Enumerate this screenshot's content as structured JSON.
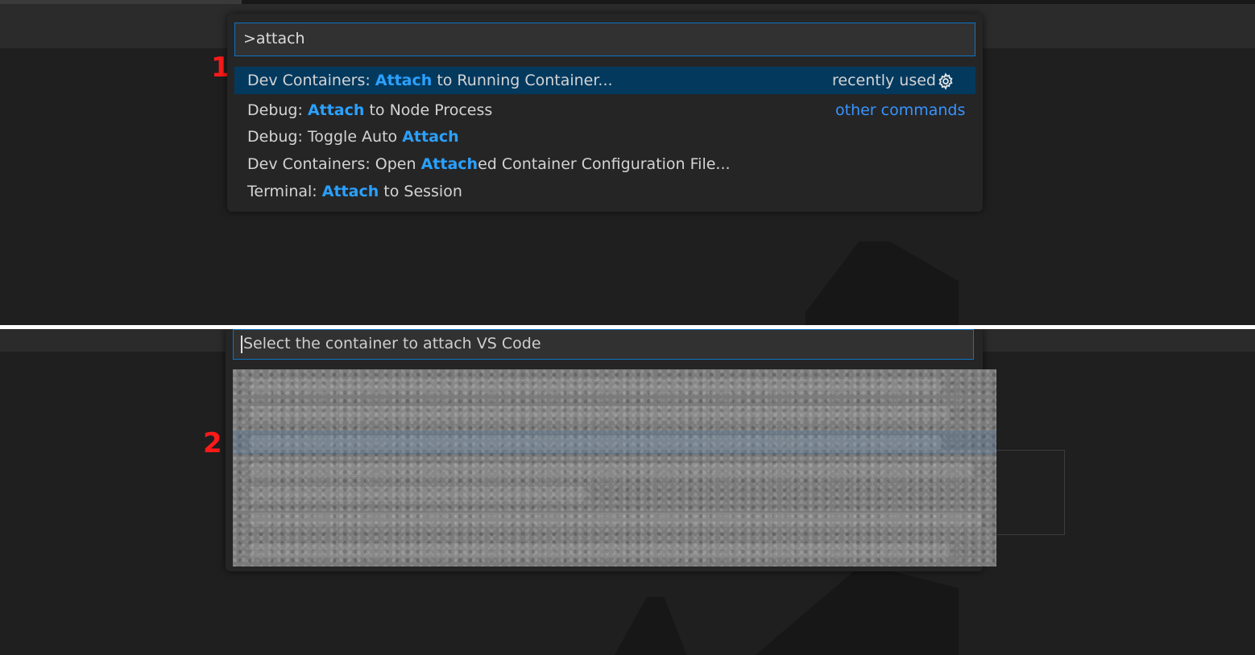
{
  "panel1": {
    "marker": "1",
    "input": {
      "value": ">attach"
    },
    "items": [
      {
        "prefix": "Dev Containers: ",
        "match": "Attach",
        "suffix": " to Running Container...",
        "meta": "recently used",
        "selected": true
      },
      {
        "prefix": "Debug: ",
        "match": "Attach",
        "suffix": " to Node Process",
        "meta": "other commands"
      },
      {
        "prefix": "Debug: Toggle Auto ",
        "match": "Attach",
        "suffix": ""
      },
      {
        "prefix": "Dev Containers: Open ",
        "match": "Attach",
        "suffix": "ed Container Configuration File..."
      },
      {
        "prefix": "Terminal: ",
        "match": "Attach",
        "suffix": " to Session"
      }
    ],
    "gear_icon": "gear-icon"
  },
  "panel2": {
    "marker": "2",
    "input": {
      "placeholder": "Select the container to attach VS Code"
    },
    "list_state": "obscured"
  },
  "colors": {
    "highlight": "#2aa1ff",
    "selected_row": "#04395e",
    "input_border": "#0e74c4",
    "marker": "#ff1a1a"
  }
}
